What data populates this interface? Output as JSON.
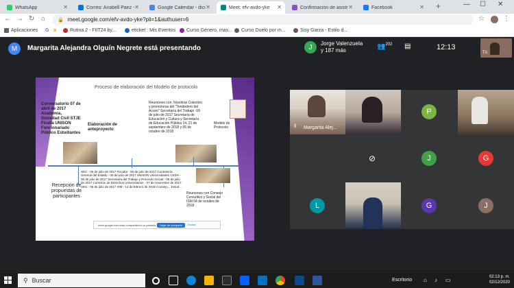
{
  "browser": {
    "tabs": [
      {
        "label": "WhatsApp",
        "color": "#25d366"
      },
      {
        "label": "Correo: Anabell Paez -",
        "color": "#0078d4"
      },
      {
        "label": "Google Calendar - dici",
        "color": "#4285f4"
      },
      {
        "label": "Meet: efv-avdo-yke",
        "color": "#00897b",
        "active": true
      },
      {
        "label": "Confirmación de asistr",
        "color": "#7e57c2"
      },
      {
        "label": "Facebook",
        "color": "#1877f2"
      }
    ],
    "new_tab": "+",
    "url": "meet.google.com/efv-avdo-yke?pli=1&authuser=6",
    "bookmarks": [
      {
        "label": "Aplicaciones",
        "color": "#5f6368"
      },
      {
        "label": "G",
        "color": "#4285f4"
      },
      {
        "label": "a",
        "color": "#ff9900"
      },
      {
        "label": "Rutina 2 - FIIT24 by...",
        "color": "#c62828"
      },
      {
        "label": "eticket : Mis Eventos",
        "color": "#1565c0"
      },
      {
        "label": "Curso Género, mas...",
        "color": "#8e24aa"
      },
      {
        "label": "Curso Duelo por m...",
        "color": "#5f6368"
      },
      {
        "label": "Sisy Garza - Estilo d...",
        "color": "#795548"
      }
    ]
  },
  "meet": {
    "presenter_initial": "M",
    "presenter_text": "Margarita Alejandra Olguín Negrete está presentando",
    "speaker_initial": "J",
    "speaker_name": "Jorge Valenzuela",
    "speaker_more": "y 187 más",
    "people_count": "202",
    "time": "12:13",
    "self_label": "Tú"
  },
  "slide": {
    "title": "Proceso de elaboración del Modelo de protocolo",
    "conversatorio": "Conversatorio 07 de abril de 2017 Academia, Sociedad Civil STJE Ficalía UNISON Funcionariado Público Estudiantes",
    "elaboracion": "Elaboración de anteproyecto",
    "reuniones1": "Reuniones con: Nosotras Colectivo y promotoras del \"Tendedero del Acoso\" Secretaría del Trabajo -09 de julio de 2017 Secretaría de Educación y Cultura y Secretaría de Educación Pública 14, 21 de septiembre de 2018 y 05 de octubre de 2018",
    "modelo": "Modelo de Protocolo",
    "recepcion": "Recepción de propuestas de participantes",
    "list": "SEC - 05 de julio de 2017 Fiscalía - 05 de julio de 2017 Contraloría General del Estado - 05 de julio de 2017 UNISON Universidades CEDH - 05 de julio de 2017 Secretaría del Trabajo y Previsión Social - 05 de julio de 2017 Comisión de Derechos Universitarios - 07 de noviembre de 2017 UES - 05 de julio de 2017 ISM - 14 de febrero de 2018 Consejo... Estud...",
    "reuniones2": "Reuniones con Consejo Consultivo y Social del ISM 04 de octubre de 2018",
    "dialog_text": "meet.google.com está compartiendo tu pantalla.",
    "dialog_button": "Dejar de compartir",
    "dialog_hide": "Ocultar"
  },
  "tiles": [
    {
      "name": "Margarita Alej...",
      "type": "video"
    },
    {
      "type": "video"
    },
    {
      "initial": "P",
      "color": "#7cb342"
    },
    {
      "type": "video"
    },
    {
      "type": "dark"
    },
    {
      "type": "camoff"
    },
    {
      "initial": "J",
      "color": "#43a047"
    },
    {
      "initial": "G",
      "color": "#e53935"
    },
    {
      "initial": "L",
      "color": "#0097a7"
    },
    {
      "type": "video"
    },
    {
      "initial": "G",
      "color": "#5e35b1"
    },
    {
      "initial": "J",
      "color": "#8d6e63"
    }
  ],
  "taskbar": {
    "search_label": "Buscar",
    "desktop_label": "Escritorio",
    "clock_time": "02:13 p. m.",
    "clock_date": "02/12/2020"
  }
}
